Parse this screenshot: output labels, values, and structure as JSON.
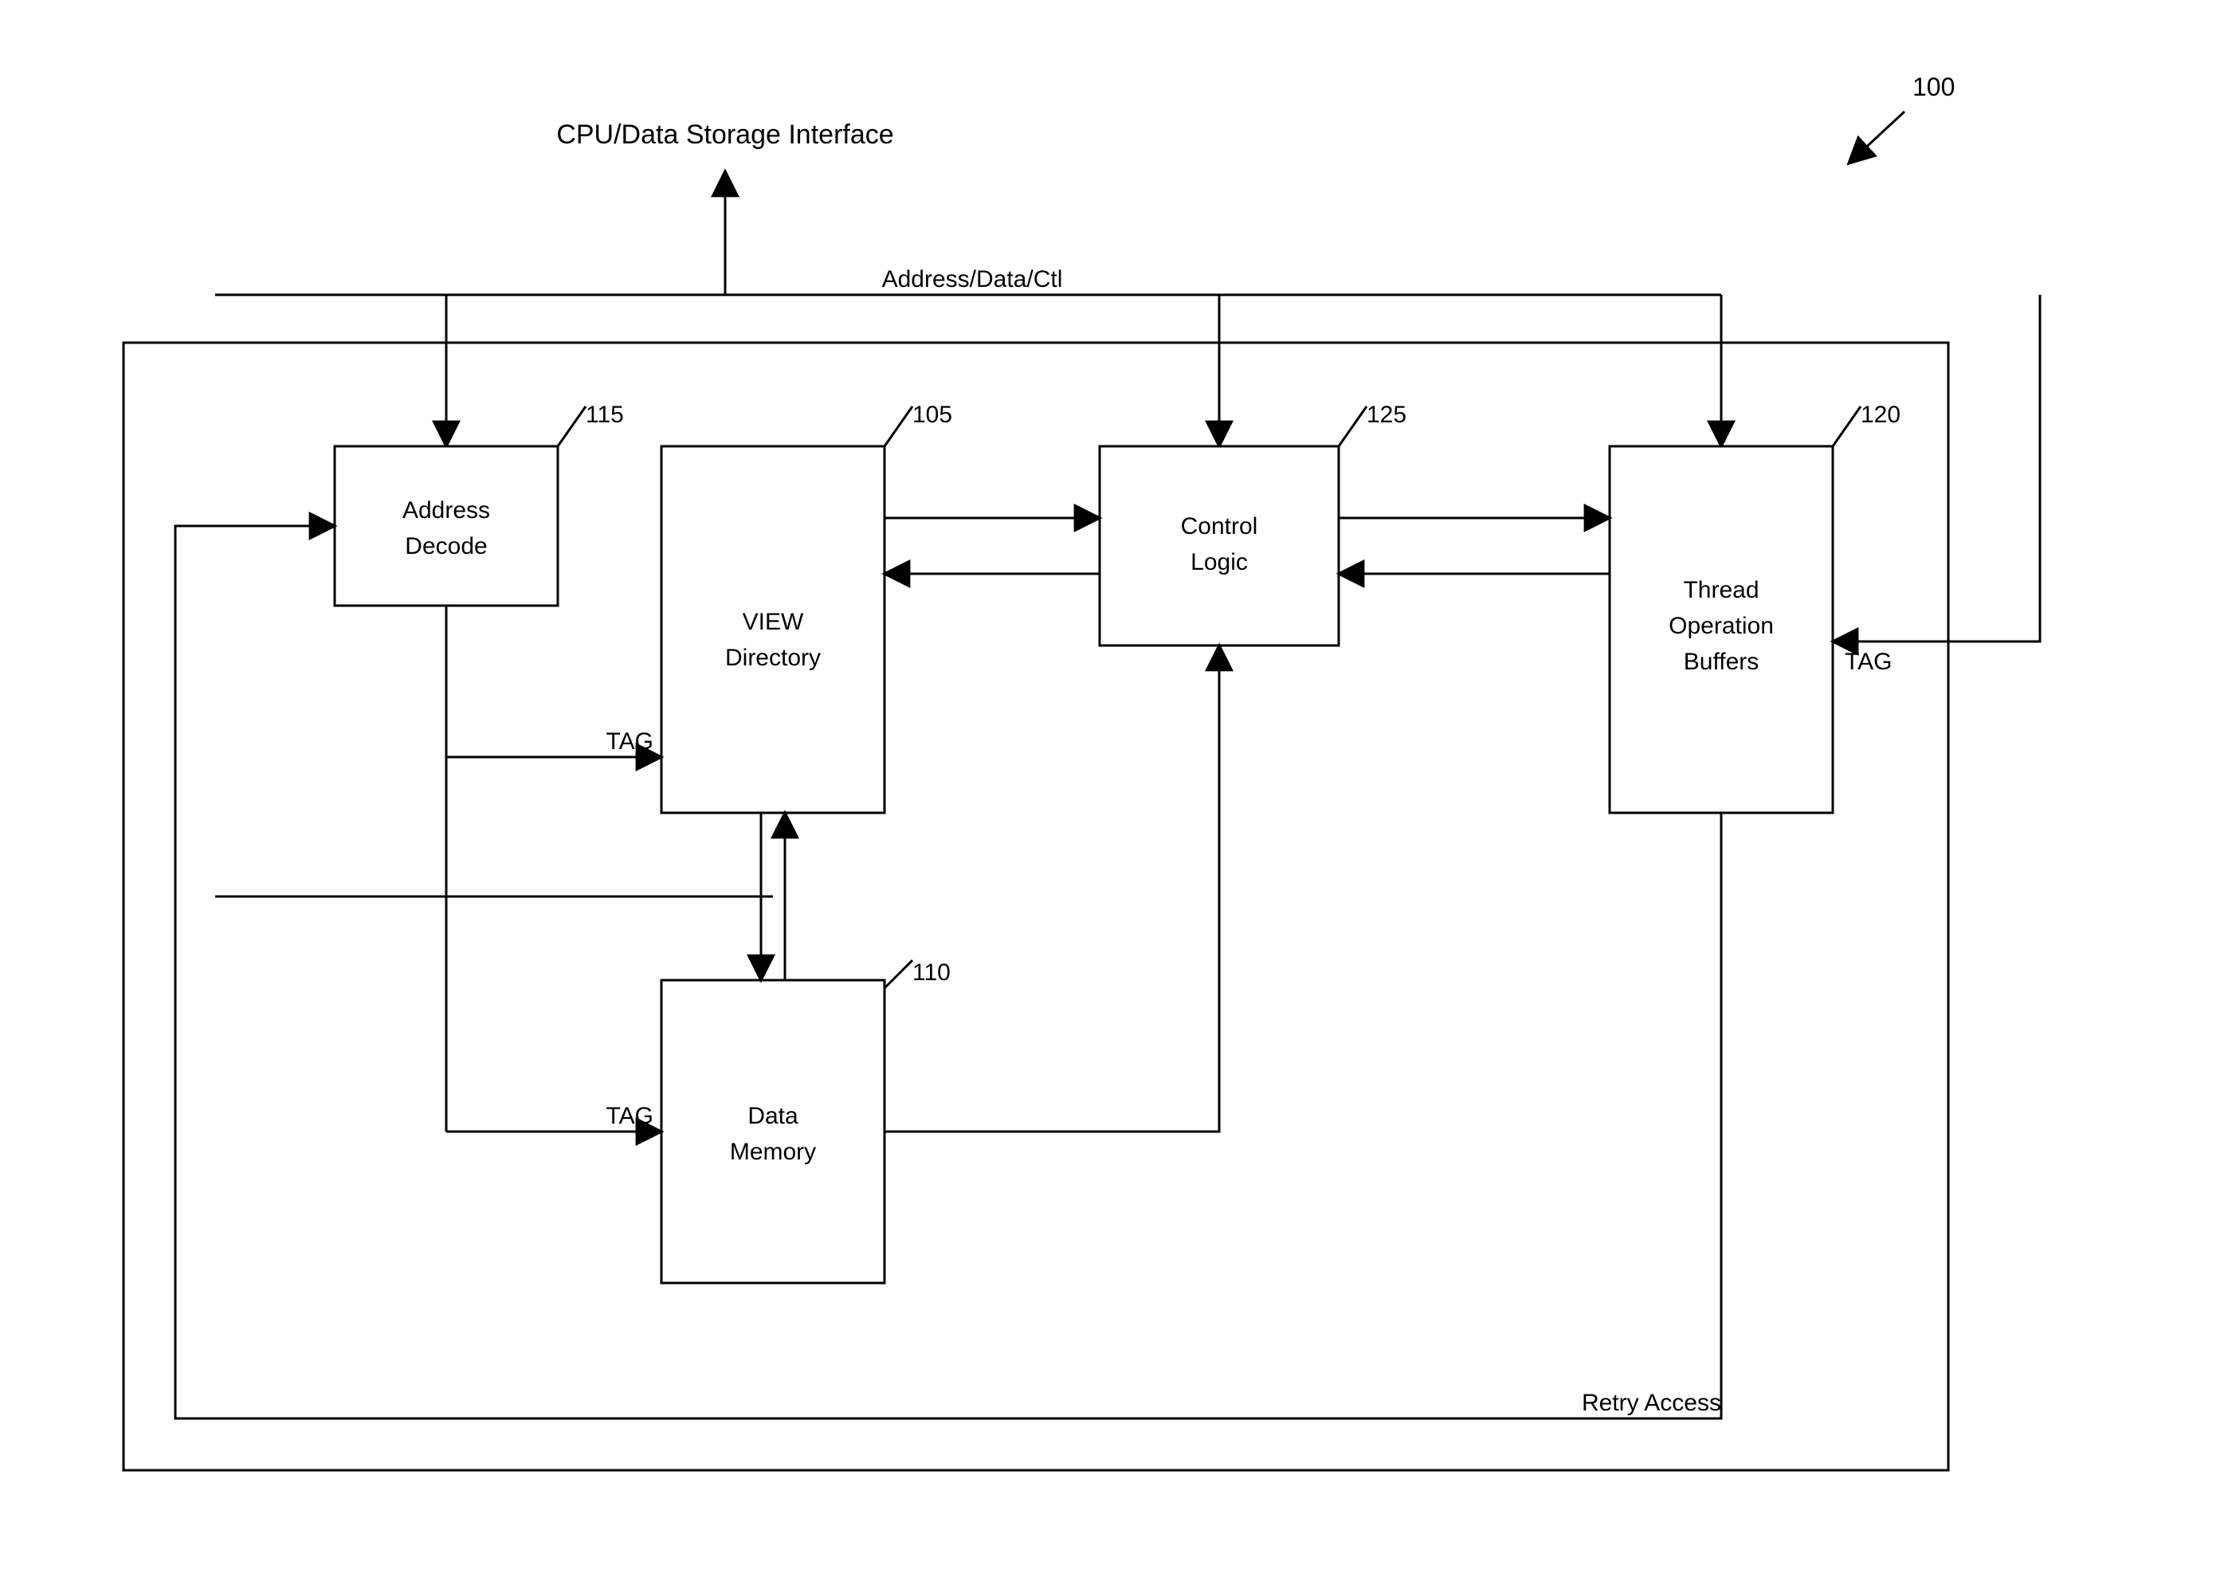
{
  "title": "CPU/Data Storage Interface",
  "bus_label": "Address/Data/Ctl",
  "retry_label": "Retry Access",
  "overall_ref": "100",
  "blocks": {
    "address_decode": {
      "line1": "Address",
      "line2": "Decode",
      "ref": "115"
    },
    "view_directory": {
      "line1": "VIEW",
      "line2": "Directory",
      "ref": "105"
    },
    "control_logic": {
      "line1": "Control",
      "line2": "Logic",
      "ref": "125"
    },
    "thread_buffers": {
      "line1": "Thread",
      "line2": "Operation",
      "line3": "Buffers",
      "ref": "120"
    },
    "data_memory": {
      "line1": "Data",
      "line2": "Memory",
      "ref": "110"
    }
  },
  "tags": {
    "to_view_dir": "TAG",
    "to_data_mem": "TAG",
    "to_thread_buf": "TAG"
  }
}
